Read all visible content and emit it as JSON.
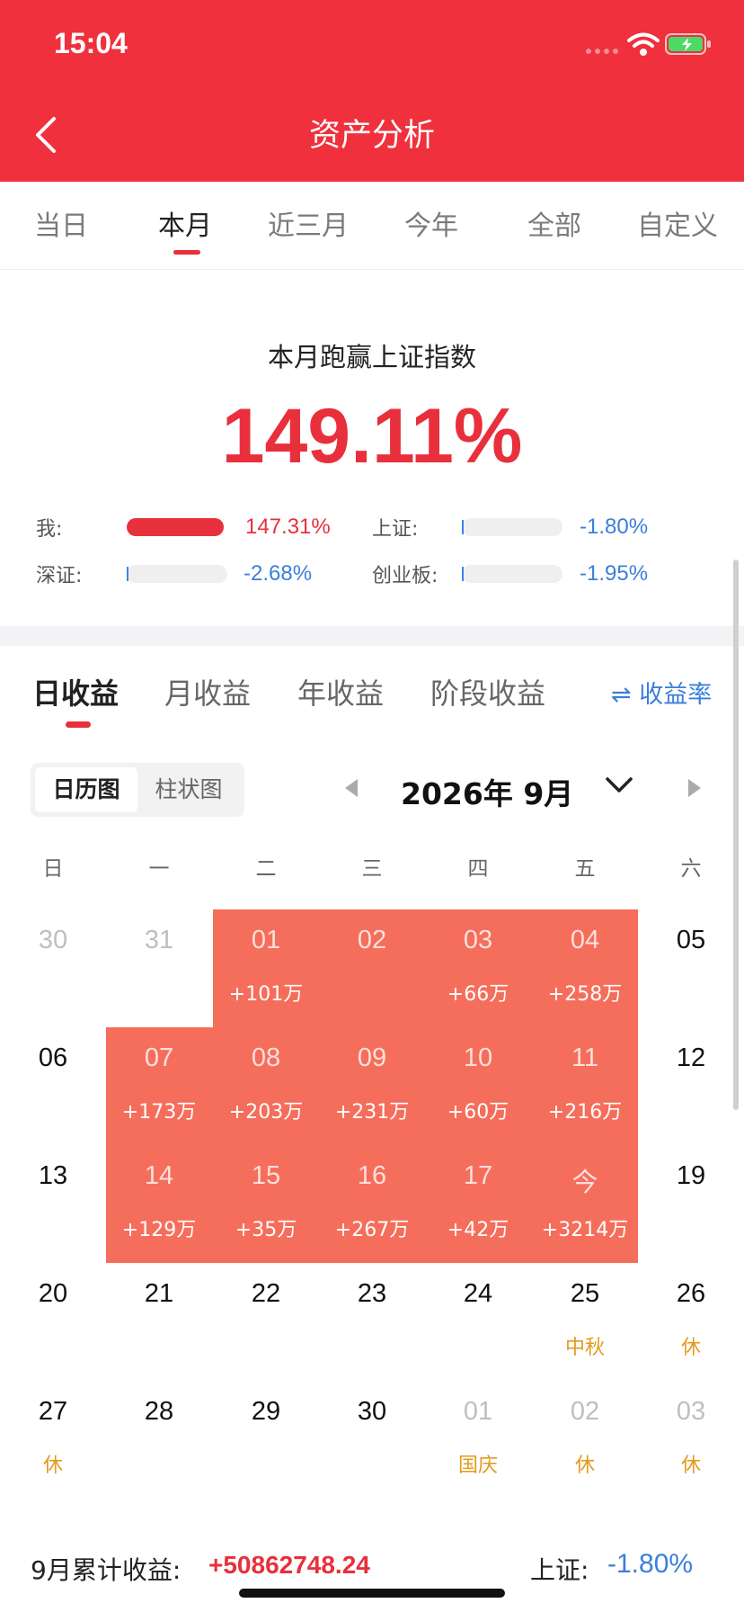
{
  "status_bar": {
    "time": "15:04"
  },
  "header": {
    "title": "资产分析"
  },
  "period_tabs": [
    {
      "label": "当日",
      "active": false
    },
    {
      "label": "本月",
      "active": true
    },
    {
      "label": "近三月",
      "active": false
    },
    {
      "label": "今年",
      "active": false
    },
    {
      "label": "全部",
      "active": false
    },
    {
      "label": "自定义",
      "active": false
    }
  ],
  "beat": {
    "title": "本月跑赢上证指数",
    "value": "149.11%"
  },
  "comparison": [
    {
      "label": "我:",
      "value": "147.31%",
      "fill": 1.0,
      "sign": "pos"
    },
    {
      "label": "上证:",
      "value": "-1.80%",
      "fill": 0.0,
      "sign": "neg"
    },
    {
      "label": "深证:",
      "value": "-2.68%",
      "fill": 0.0,
      "sign": "neg"
    },
    {
      "label": "创业板:",
      "value": "-1.95%",
      "fill": 0.0,
      "sign": "neg"
    }
  ],
  "profit_tabs": [
    {
      "label": "日收益",
      "active": true
    },
    {
      "label": "月收益",
      "active": false
    },
    {
      "label": "年收益",
      "active": false
    },
    {
      "label": "阶段收益",
      "active": false
    }
  ],
  "ratio_toggle": {
    "icon": "swap-arrows-icon",
    "label": "收益率"
  },
  "view_toggle": {
    "calendar": "日历图",
    "bar": "柱状图"
  },
  "month": {
    "label": "2026年 9月"
  },
  "weekdays": [
    "日",
    "一",
    "二",
    "三",
    "四",
    "五",
    "六"
  ],
  "calendar_weeks": [
    [
      {
        "day": "30",
        "type": "out",
        "sub": ""
      },
      {
        "day": "31",
        "type": "out",
        "sub": ""
      },
      {
        "day": "01",
        "type": "hl",
        "sub": "+101万"
      },
      {
        "day": "02",
        "type": "hl",
        "sub": ""
      },
      {
        "day": "03",
        "type": "hl",
        "sub": "+66万"
      },
      {
        "day": "04",
        "type": "hl",
        "sub": "+258万"
      },
      {
        "day": "05",
        "type": "norm",
        "sub": ""
      }
    ],
    [
      {
        "day": "06",
        "type": "norm",
        "sub": ""
      },
      {
        "day": "07",
        "type": "hl",
        "sub": "+173万"
      },
      {
        "day": "08",
        "type": "hl",
        "sub": "+203万"
      },
      {
        "day": "09",
        "type": "hl",
        "sub": "+231万"
      },
      {
        "day": "10",
        "type": "hl",
        "sub": "+60万"
      },
      {
        "day": "11",
        "type": "hl",
        "sub": "+216万"
      },
      {
        "day": "12",
        "type": "norm",
        "sub": ""
      }
    ],
    [
      {
        "day": "13",
        "type": "norm",
        "sub": ""
      },
      {
        "day": "14",
        "type": "hl",
        "sub": "+129万"
      },
      {
        "day": "15",
        "type": "hl",
        "sub": "+35万"
      },
      {
        "day": "16",
        "type": "hl",
        "sub": "+267万"
      },
      {
        "day": "17",
        "type": "hl",
        "sub": "+42万"
      },
      {
        "day": "今",
        "type": "hl",
        "sub": "+3214万"
      },
      {
        "day": "19",
        "type": "norm",
        "sub": ""
      }
    ],
    [
      {
        "day": "20",
        "type": "norm",
        "sub": ""
      },
      {
        "day": "21",
        "type": "norm",
        "sub": ""
      },
      {
        "day": "22",
        "type": "norm",
        "sub": ""
      },
      {
        "day": "23",
        "type": "norm",
        "sub": ""
      },
      {
        "day": "24",
        "type": "norm",
        "sub": ""
      },
      {
        "day": "25",
        "type": "norm",
        "sub": "中秋"
      },
      {
        "day": "26",
        "type": "norm",
        "sub": "休"
      }
    ],
    [
      {
        "day": "27",
        "type": "norm",
        "sub": "休"
      },
      {
        "day": "28",
        "type": "norm",
        "sub": ""
      },
      {
        "day": "29",
        "type": "norm",
        "sub": ""
      },
      {
        "day": "30",
        "type": "norm",
        "sub": ""
      },
      {
        "day": "01",
        "type": "out",
        "sub": "国庆"
      },
      {
        "day": "02",
        "type": "out",
        "sub": "休"
      },
      {
        "day": "03",
        "type": "out",
        "sub": "休"
      }
    ]
  ],
  "summary": {
    "month_label": "9月累计收益:",
    "month_value": "+50862748.24",
    "index_label": "上证:",
    "index_value": "-1.80%"
  },
  "colors": {
    "brand_red": "#f0303c",
    "highlight": "#f56e5b",
    "negative_blue": "#3b7fd9",
    "holiday": "#e39a1c"
  }
}
